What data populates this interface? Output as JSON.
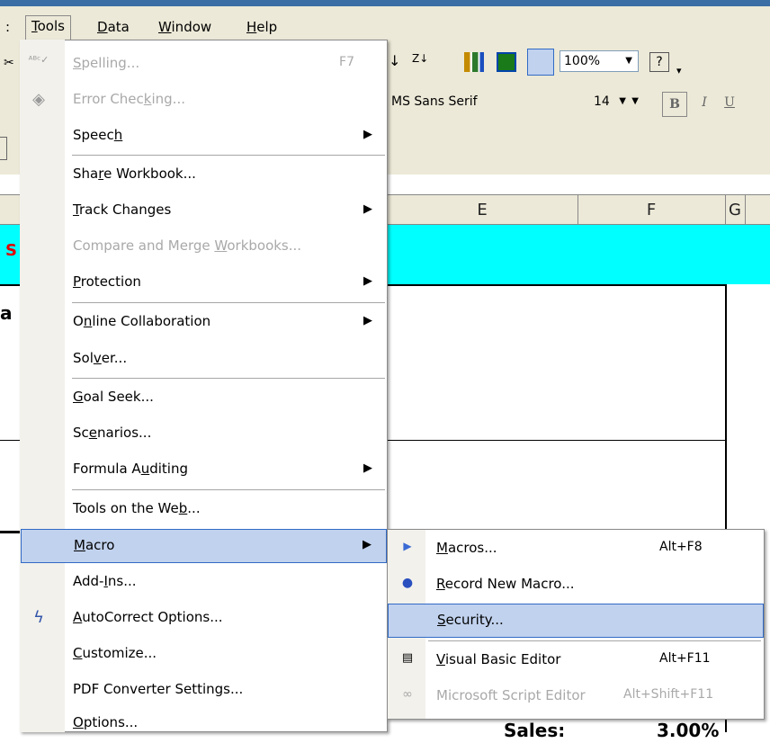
{
  "menubar": {
    "items": [
      {
        "label": ":"
      },
      {
        "label": "Tools"
      },
      {
        "label": "Data"
      },
      {
        "label": "Window"
      },
      {
        "label": "Help"
      }
    ]
  },
  "toolbar": {
    "zoom": "100%",
    "font_name": "MS Sans Serif",
    "font_size": "14",
    "bold_label": "B",
    "italic_label": "I",
    "underline_label": "U"
  },
  "sheet": {
    "columns": [
      "E",
      "F",
      "G"
    ],
    "left_fragments": [
      "S",
      "a",
      "]"
    ],
    "bottom_text": "Sales:",
    "bottom_value": "3.00%"
  },
  "tools_menu": {
    "items": [
      {
        "label": "Spelling...",
        "shortcut": "F7",
        "disabled": true,
        "icon": "spelling-icon"
      },
      {
        "label": "Error Checking...",
        "disabled": true,
        "icon": "error-checking-icon"
      },
      {
        "label": "Speech",
        "submenu": true
      },
      {
        "label": "Share Workbook..."
      },
      {
        "label": "Track Changes",
        "submenu": true
      },
      {
        "label": "Compare and Merge Workbooks...",
        "disabled": true
      },
      {
        "label": "Protection",
        "submenu": true
      },
      {
        "label": "Online Collaboration",
        "submenu": true
      },
      {
        "label": "Solver..."
      },
      {
        "label": "Goal Seek..."
      },
      {
        "label": "Scenarios..."
      },
      {
        "label": "Formula Auditing",
        "submenu": true
      },
      {
        "label": "Tools on the Web..."
      },
      {
        "label": "Macro",
        "submenu": true,
        "highlighted": true
      },
      {
        "label": "Add-Ins..."
      },
      {
        "label": "AutoCorrect Options...",
        "icon": "autocorrect-icon"
      },
      {
        "label": "Customize..."
      },
      {
        "label": "PDF Converter Settings..."
      },
      {
        "label": "Options..."
      }
    ]
  },
  "macro_submenu": {
    "items": [
      {
        "label": "Macros...",
        "shortcut": "Alt+F8",
        "icon": "play-icon"
      },
      {
        "label": "Record New Macro...",
        "icon": "record-icon"
      },
      {
        "label": "Security...",
        "highlighted": true
      },
      {
        "label": "Visual Basic Editor",
        "shortcut": "Alt+F11",
        "icon": "vb-editor-icon"
      },
      {
        "label": "Microsoft Script Editor",
        "shortcut": "Alt+Shift+F11",
        "disabled": true,
        "icon": "script-editor-icon"
      }
    ]
  },
  "colors": {
    "menu_highlight": "#c1d2ee",
    "highlight_border": "#316ac5",
    "cell_fill": "#00ffff",
    "title_bar": "#3a6ea5"
  }
}
